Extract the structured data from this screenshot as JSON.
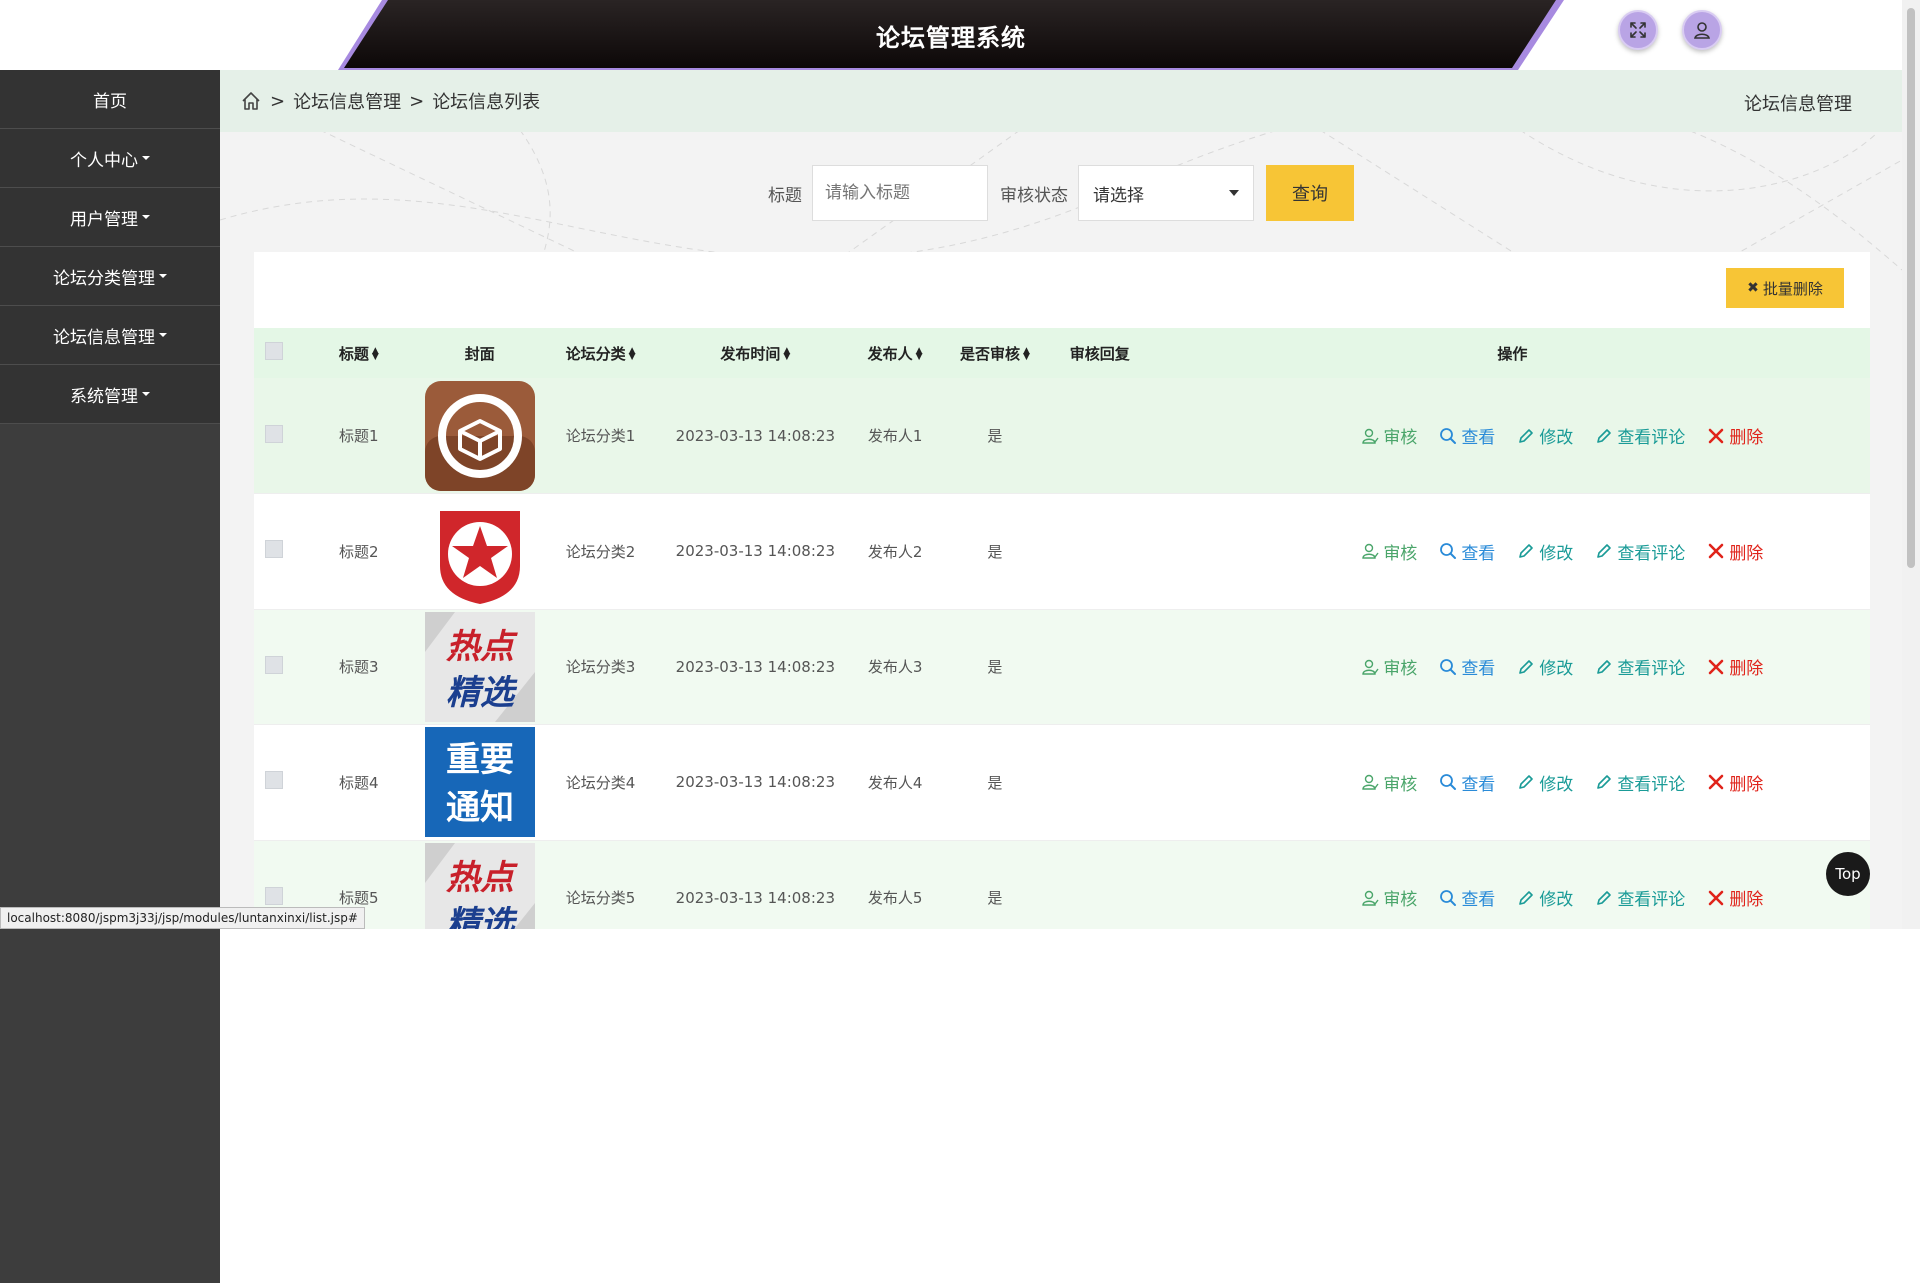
{
  "header": {
    "app_title": "论坛管理系统"
  },
  "sidebar": {
    "items": [
      {
        "label": "首页",
        "has_caret": false
      },
      {
        "label": "个人中心",
        "has_caret": true
      },
      {
        "label": "用户管理",
        "has_caret": true
      },
      {
        "label": "论坛分类管理",
        "has_caret": true
      },
      {
        "label": "论坛信息管理",
        "has_caret": true
      },
      {
        "label": "系统管理",
        "has_caret": true
      }
    ]
  },
  "breadcrumb": {
    "sep": ">",
    "level1": "论坛信息管理",
    "level2": "论坛信息列表",
    "right_title": "论坛信息管理"
  },
  "search": {
    "title_label": "标题",
    "title_placeholder": "请输入标题",
    "status_label": "审核状态",
    "status_value": "请选择",
    "query_button": "查询"
  },
  "toolbar": {
    "batch_delete": "批量删除"
  },
  "table": {
    "headers": {
      "title": "标题",
      "cover": "封面",
      "category": "论坛分类",
      "time": "发布时间",
      "author": "发布人",
      "audited": "是否审核",
      "reply": "审核回复",
      "ops": "操作"
    },
    "ops_labels": {
      "audit": "审核",
      "view": "查看",
      "edit": "修改",
      "comments": "查看评论",
      "delete": "删除"
    },
    "rows": [
      {
        "title": "标题1",
        "cover": "box-app-icon",
        "category": "论坛分类1",
        "time": "2023-03-13 14:08:23",
        "author": "发布人1",
        "audited": "是",
        "reply": ""
      },
      {
        "title": "标题2",
        "cover": "red-star-icon",
        "category": "论坛分类2",
        "time": "2023-03-13 14:08:23",
        "author": "发布人2",
        "audited": "是",
        "reply": ""
      },
      {
        "title": "标题3",
        "cover": "hot-pick-image",
        "cover_text": [
          "热点",
          "精选"
        ],
        "category": "论坛分类3",
        "time": "2023-03-13 14:08:23",
        "author": "发布人3",
        "audited": "是",
        "reply": ""
      },
      {
        "title": "标题4",
        "cover": "important-notice-image",
        "cover_text": [
          "重要",
          "通知"
        ],
        "category": "论坛分类4",
        "time": "2023-03-13 14:08:23",
        "author": "发布人4",
        "audited": "是",
        "reply": ""
      },
      {
        "title": "标题5",
        "cover": "hot-pick-image",
        "cover_text": [
          "热点",
          "精选"
        ],
        "category": "论坛分类5",
        "time": "2023-03-13 14:08:23",
        "author": "发布人5",
        "audited": "是",
        "reply": ""
      }
    ]
  },
  "status_bar": {
    "url": "localhost:8080/jspm3j33j/jsp/modules/luntanxinxi/list.jsp#"
  },
  "floating": {
    "top_label": "Top"
  },
  "colors": {
    "accent_yellow": "#f7c536",
    "sidebar_bg": "#333333",
    "header_row_bg": "#e4f7e6",
    "audit_green": "#4aa56a",
    "view_blue": "#2a8bd8",
    "edit_teal": "#1a9b97",
    "delete_red": "#e0231a"
  }
}
